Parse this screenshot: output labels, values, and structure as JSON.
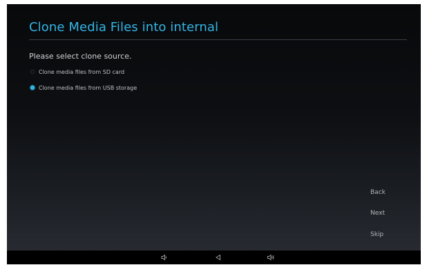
{
  "title": "Clone Media Files into internal",
  "prompt": "Please select clone source.",
  "options": [
    {
      "label": "Clone media files from SD card",
      "selected": false
    },
    {
      "label": "Clone media files from USB storage",
      "selected": true
    }
  ],
  "buttons": {
    "back": "Back",
    "next": "Next",
    "skip": "Skip"
  },
  "navbar": {
    "icons": [
      "volume-down-icon",
      "back-icon",
      "volume-up-icon"
    ]
  },
  "colors": {
    "accent": "#33b5e5",
    "background": "#0d0f12",
    "text": "#cfd2d6"
  }
}
